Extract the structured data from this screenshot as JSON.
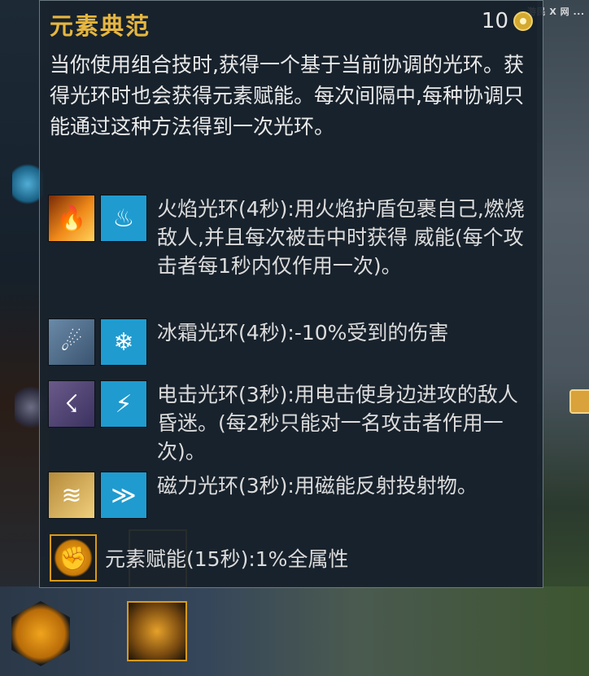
{
  "watermark": "游民 X 网 ...",
  "tooltip": {
    "title": "元素典范",
    "cost": "10",
    "description": "当你使用组合技时,获得一个基于当前协调的光环。获得光环时也会获得元素赋能。每次间隔中,每种协调只能通过这种方法得到一次光环。",
    "auras": [
      {
        "icons": [
          "fire-field-icon",
          "fire-attunement-icon"
        ],
        "text": "火焰光环(4秒):用火焰护盾包裹自己,燃烧敌人,并且每次被击中时获得 威能(每个攻击者每1秒内仅作用一次)。"
      },
      {
        "icons": [
          "ice-field-icon",
          "water-attunement-icon"
        ],
        "text": "冰霜光环(4秒):-10%受到的伤害"
      },
      {
        "icons": [
          "lightning-field-icon",
          "air-attunement-icon"
        ],
        "text": "电击光环(3秒):用电击使身边进攻的敌人昏迷。(每2秒只能对一名攻击者作用一次)。"
      },
      {
        "icons": [
          "sand-field-icon",
          "earth-attunement-icon"
        ],
        "text": "磁力光环(3秒):用磁能反射投射物。"
      }
    ],
    "empower": {
      "icon": "empowerment-icon",
      "text": "元素赋能(15秒):1%全属性"
    }
  },
  "colors": {
    "title": "#e6b640",
    "text": "#dcdcdc",
    "panel": "#18222c",
    "attunement_blue": "#1f9bd0"
  }
}
